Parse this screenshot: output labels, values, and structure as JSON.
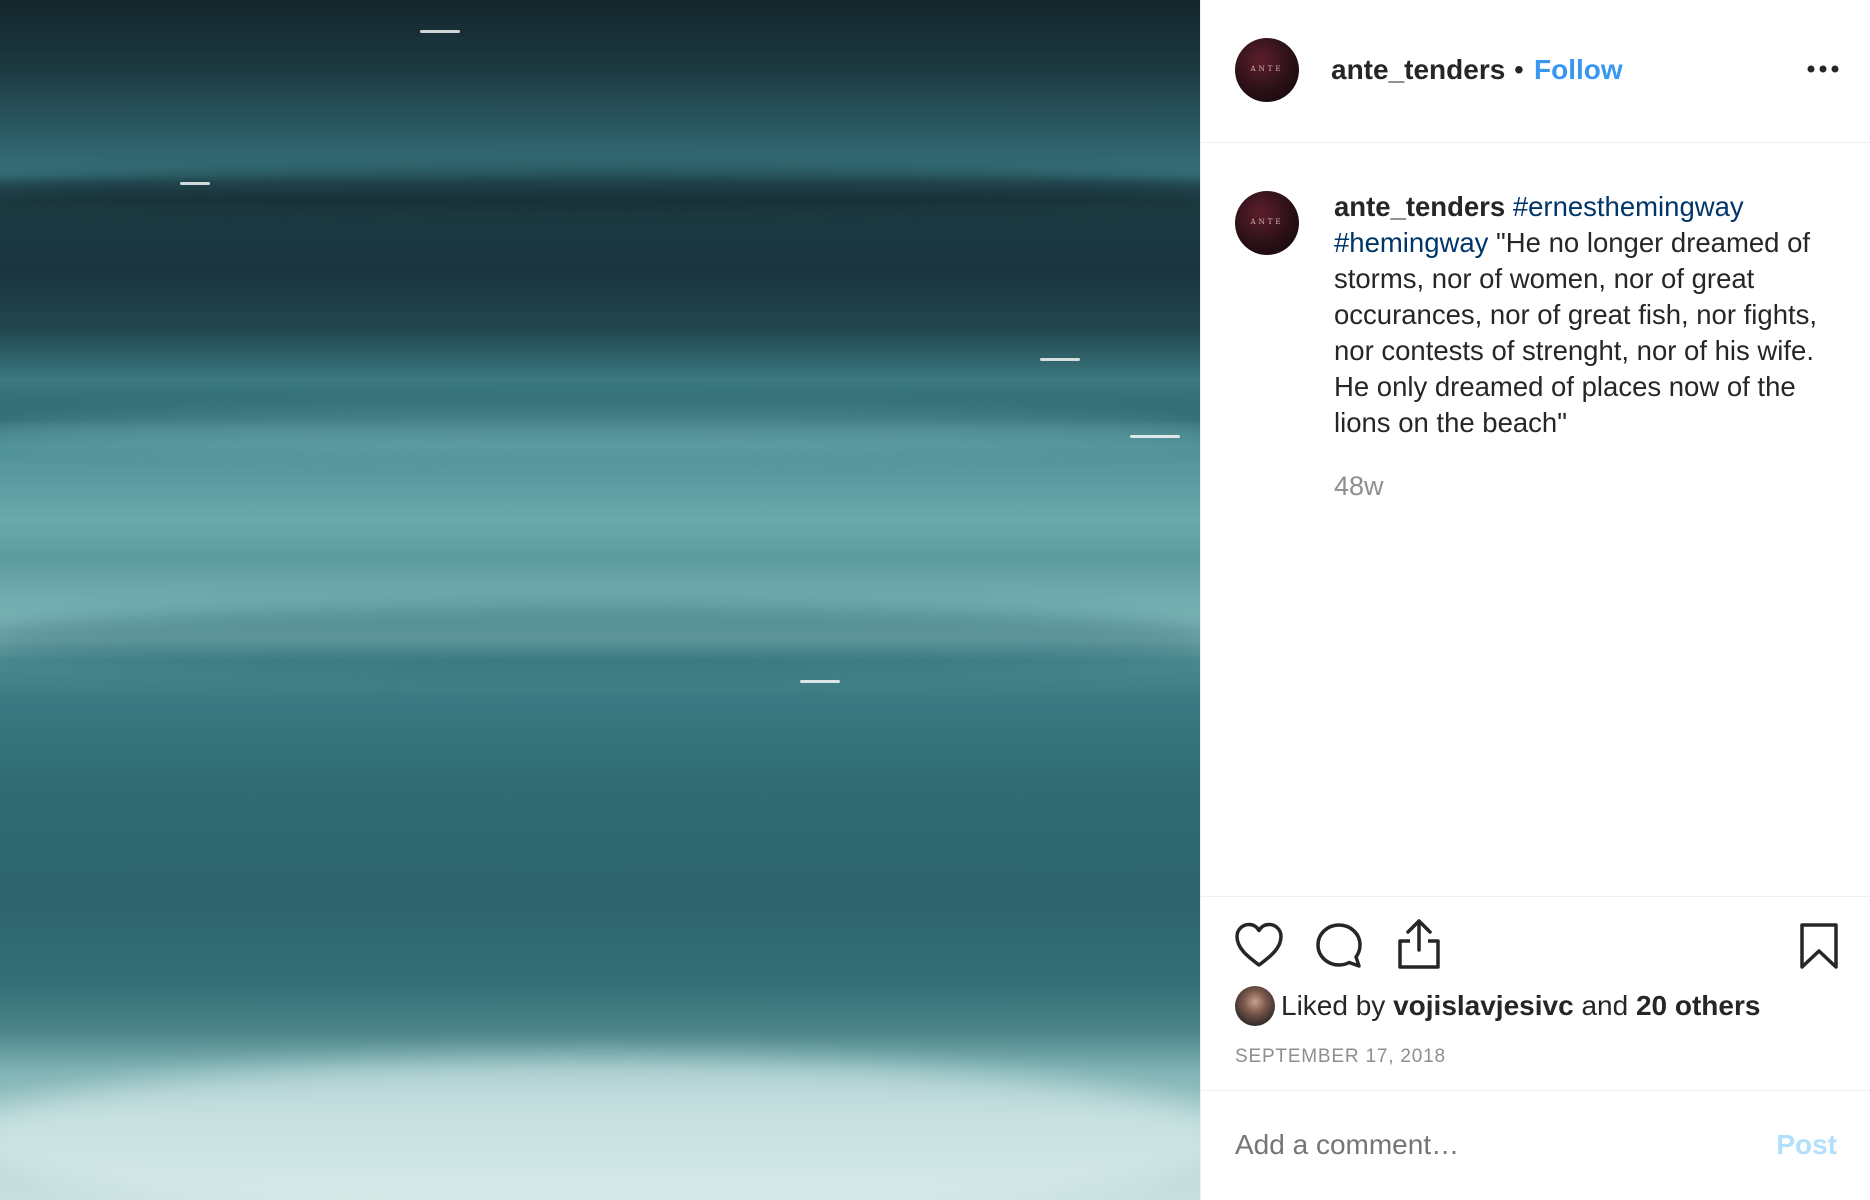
{
  "post": {
    "image_icon": "ocean-waves-photo"
  },
  "header": {
    "username": "ante_tenders",
    "separator": "•",
    "follow_label": "Follow",
    "more_icon": "more-options-icon",
    "avatar_text": "ANTE"
  },
  "caption": {
    "username": "ante_tenders",
    "hashtag1": "#ernesthemingway",
    "hashtag2": "#hemingway",
    "body": "\"He no longer dreamed of storms, nor of women, nor of great occurances, nor of great fish, nor fights, nor contests of strenght, nor of his wife. He only dreamed of places now of the lions on the beach\"",
    "time": "48w"
  },
  "actions": {
    "like_icon": "heart-icon",
    "comment_icon": "comment-icon",
    "share_icon": "share-icon",
    "save_icon": "bookmark-icon"
  },
  "likes": {
    "prefix": "Liked by",
    "user": "vojislavjesivc",
    "middle": "and",
    "others": "20 others"
  },
  "date": "SEPTEMBER 17, 2018",
  "comment": {
    "placeholder": "Add a comment…",
    "post_label": "Post"
  },
  "colors": {
    "link_blue": "#3897f0",
    "hashtag": "#003569",
    "muted": "#8e8e8e",
    "post_disabled": "#b2dffc"
  }
}
